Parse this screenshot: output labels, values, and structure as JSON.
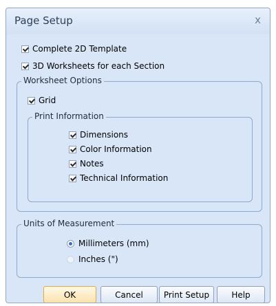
{
  "dialog": {
    "title": "Page Setup",
    "close_label": "x"
  },
  "options": {
    "complete_2d": {
      "label": "Complete 2D Template",
      "checked": true
    },
    "worksheets_3d": {
      "label": "3D Worksheets for each Section",
      "checked": true
    }
  },
  "worksheet_options": {
    "legend": "Worksheet Options",
    "grid": {
      "label": "Grid",
      "checked": true
    },
    "print_information": {
      "legend": "Print Information",
      "items": [
        {
          "label": "Dimensions",
          "checked": true
        },
        {
          "label": "Color Information",
          "checked": true
        },
        {
          "label": "Notes",
          "checked": true
        },
        {
          "label": "Technical Information",
          "checked": true
        }
      ]
    }
  },
  "units": {
    "legend": "Units of Measurement",
    "options": [
      {
        "label": "Millimeters (mm)",
        "selected": true
      },
      {
        "label": "Inches (\")",
        "selected": false
      }
    ]
  },
  "buttons": {
    "ok": "OK",
    "cancel": "Cancel",
    "print_setup": "Print Setup",
    "help": "Help"
  }
}
